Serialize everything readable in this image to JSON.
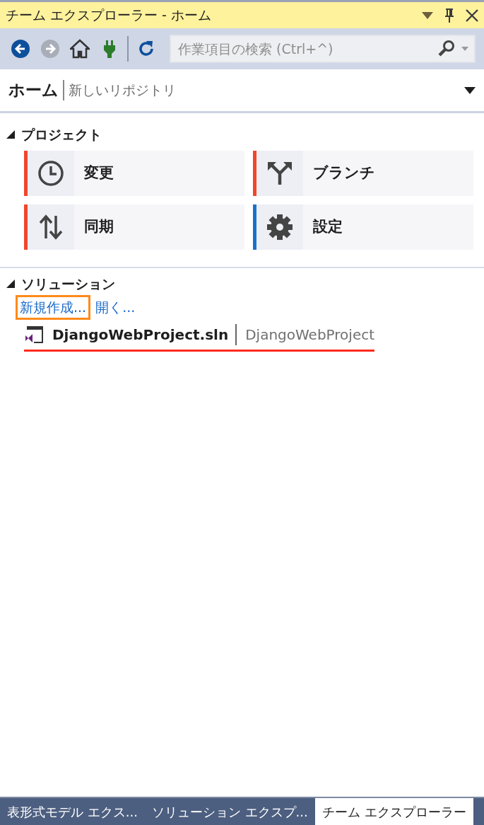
{
  "window": {
    "title": "チーム エクスプローラー - ホーム"
  },
  "toolbar": {
    "buttons": [
      {
        "kind": "back",
        "disabled": false
      },
      {
        "kind": "forward",
        "disabled": true
      },
      {
        "kind": "home",
        "disabled": false
      },
      {
        "kind": "connect",
        "disabled": false
      },
      {
        "kind": "refresh",
        "disabled": false
      }
    ],
    "search": {
      "placeholder": "作業項目の検索 (Ctrl+^)"
    }
  },
  "header": {
    "title": "ホーム",
    "subtitle": "新しいリポジトリ"
  },
  "sections": [
    {
      "title": "プロジェクト",
      "expanded": true,
      "tiles": [
        {
          "label": "変更",
          "kind": "clock",
          "color": "#f0472b"
        },
        {
          "label": "ブランチ",
          "kind": "branch",
          "color": "#f0472b"
        },
        {
          "label": "同期",
          "kind": "sync",
          "color": "#f0472b"
        },
        {
          "label": "設定",
          "kind": "gear",
          "color": "#1c71c9"
        }
      ]
    },
    {
      "title": "ソリューション",
      "expanded": true,
      "links": [
        {
          "label": "新規作成...",
          "highlighted": true
        },
        {
          "label": "開く...",
          "highlighted": false
        }
      ],
      "solutions": [
        {
          "name": "DjangoWebProject.sln",
          "folder": "DjangoWebProject",
          "underlined": true
        }
      ]
    }
  ],
  "bottom_tabs": [
    {
      "label": "表形式モデル エクス...",
      "selected": false
    },
    {
      "label": "ソリューション エクスプ...",
      "selected": false
    },
    {
      "label": "チーム エクスプローラー",
      "selected": true
    }
  ]
}
